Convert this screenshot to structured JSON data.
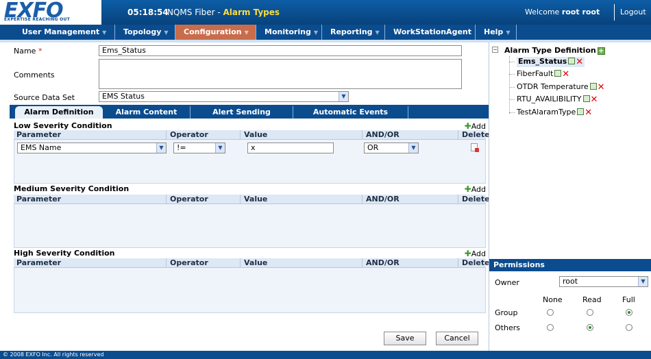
{
  "header": {
    "logo": "EXFO",
    "logo_tag": "EXPERTISE REACHING OUT",
    "clock": "05:18:54",
    "app_name": "NQMS Fiber",
    "separator": " - ",
    "page_name": "Alarm Types",
    "welcome": "Welcome",
    "user": "root root",
    "logout": "Logout"
  },
  "menu": {
    "items": [
      {
        "label": "User Management"
      },
      {
        "label": "Topology"
      },
      {
        "label": "Configuration"
      },
      {
        "label": "Monitoring"
      },
      {
        "label": "Reporting"
      },
      {
        "label": "WorkStationAgent"
      },
      {
        "label": "Help"
      }
    ],
    "active": "Configuration"
  },
  "form": {
    "name_label": "Name",
    "required_marker": "*",
    "name_value": "Ems_Status",
    "comments_label": "Comments",
    "comments_value": "",
    "source_label": "Source Data Set",
    "source_value": "EMS Status"
  },
  "tabs": [
    {
      "label": "Alarm Definition"
    },
    {
      "label": "Alarm Content"
    },
    {
      "label": "Alert Sending"
    },
    {
      "label": "Automatic Events"
    }
  ],
  "sections": {
    "low": {
      "title": "Low Severity Condition"
    },
    "medium": {
      "title": "Medium Severity Condition"
    },
    "high": {
      "title": "High Severity Condition"
    },
    "add_label": "Add"
  },
  "columns": {
    "parameter": "Parameter",
    "operator": "Operator",
    "value": "Value",
    "andor": "AND/OR",
    "delete": "Delete"
  },
  "low_row": {
    "parameter": "EMS Name",
    "operator": "!=",
    "value": "x",
    "andor": "OR"
  },
  "buttons": {
    "save": "Save",
    "cancel": "Cancel"
  },
  "tree": {
    "toggle": "−",
    "root": "Alarm Type Definition",
    "items": [
      {
        "label": "Ems_Status"
      },
      {
        "label": "FiberFault"
      },
      {
        "label": "OTDR Temperature"
      },
      {
        "label": "RTU_AVAILIBILITY"
      },
      {
        "label": "TestAlaramType"
      }
    ],
    "selected": "Ems_Status"
  },
  "permissions": {
    "title": "Permissions",
    "owner_label": "Owner",
    "owner_value": "root",
    "columns": [
      "None",
      "Read",
      "Full"
    ],
    "group_label": "Group",
    "group_selected": "Full",
    "others_label": "Others",
    "others_selected": "Read"
  },
  "footer": {
    "copyright": "© 2008 EXFO Inc. All rights reserved"
  },
  "icons": {
    "dropdown": "chevron-down-icon",
    "add": "plus-icon",
    "delete": "delete-row-icon",
    "copy": "copy-icon",
    "remove": "remove-x-icon",
    "tree_add": "add-icon",
    "collapse": "collapse-icon"
  },
  "colors": {
    "header_blue": "#0b4c8f",
    "active_menu": "#c96c4c",
    "page_name": "#ffdc3a",
    "required": "#dd2222"
  }
}
